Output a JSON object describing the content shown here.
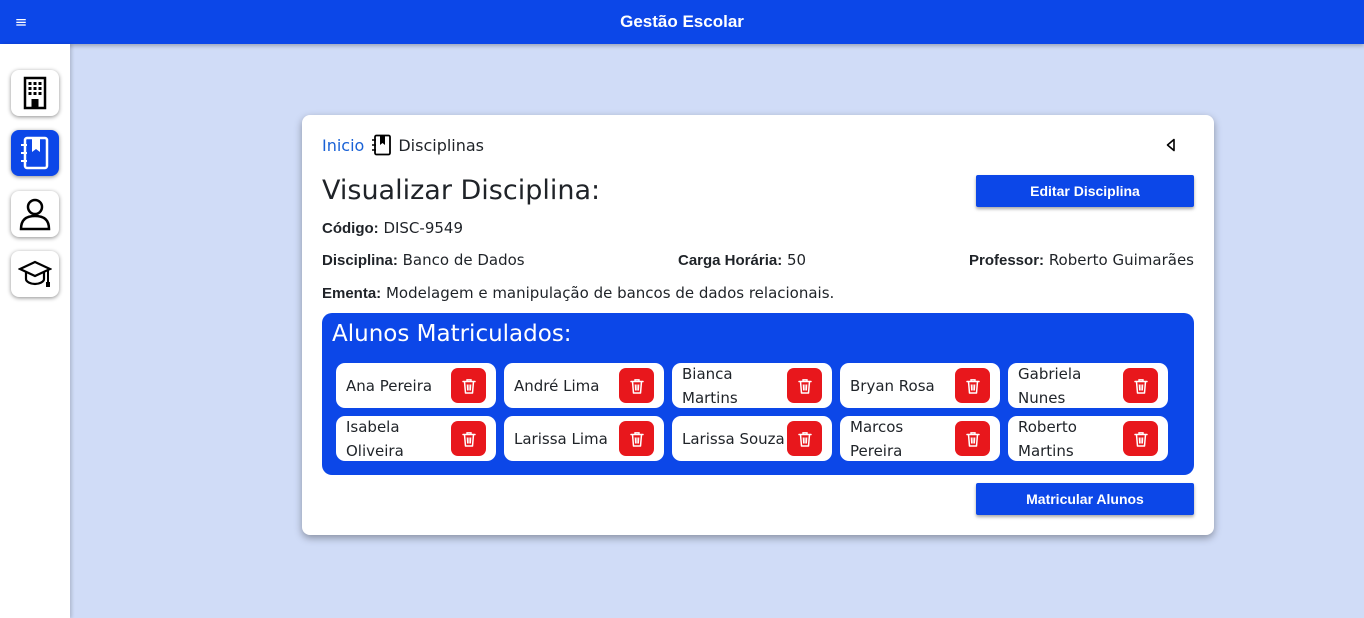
{
  "app": {
    "title": "Gestão Escolar"
  },
  "topbar": {
    "menu_icon": "hamburger-icon"
  },
  "sidebar": {
    "items": [
      {
        "name": "building-icon",
        "active": false
      },
      {
        "name": "notebook-bookmark-icon",
        "active": true
      },
      {
        "name": "user-icon",
        "active": false
      },
      {
        "name": "graduation-cap-icon",
        "active": false
      }
    ]
  },
  "breadcrumb": {
    "home": "Inicio",
    "current": "Disciplinas",
    "icon": "notebook-icon"
  },
  "page": {
    "title": "Visualizar Disciplina:",
    "edit_button": "Editar Disciplina",
    "enroll_button": "Matricular Alunos"
  },
  "discipline": {
    "code_label": "Código:",
    "code": "DISC-9549",
    "name_label": "Disciplina:",
    "name": "Banco de Dados",
    "hours_label": "Carga Horária:",
    "hours": "50",
    "professor_label": "Professor:",
    "professor": "Roberto Guimarães",
    "syllabus_label": "Ementa:",
    "syllabus": "Modelagem e manipulação de bancos de dados relacionais."
  },
  "students": {
    "title": "Alunos Matriculados:",
    "list": [
      "Ana Pereira",
      "André Lima",
      "Bianca Martins",
      "Bryan Rosa",
      "Gabriela Nunes",
      "Isabela Oliveira",
      "Larissa Lima",
      "Larissa Souza",
      "Marcos Pereira",
      "Roberto Martins"
    ]
  },
  "colors": {
    "primary": "#0c47e8",
    "danger": "#e8171c",
    "background": "#d0dcf7",
    "link": "#1a62d6"
  }
}
